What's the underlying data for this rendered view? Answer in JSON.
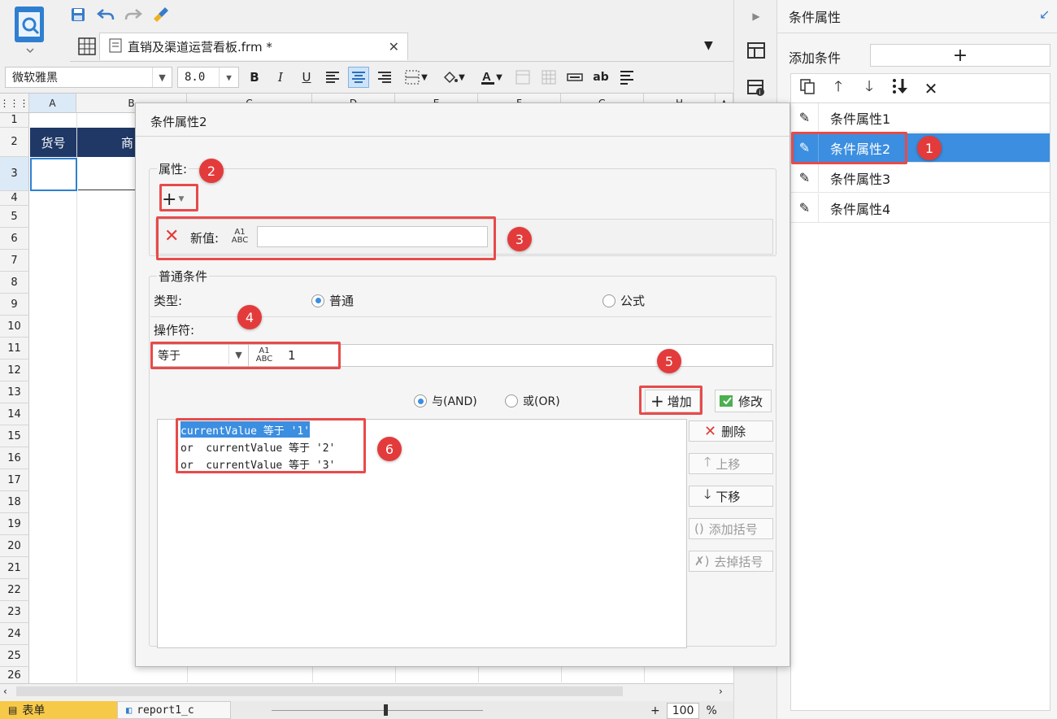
{
  "editor": {
    "file_tab": "直销及渠道运营看板.frm *",
    "font_name": "微软雅黑",
    "font_size": "8.0",
    "columns": [
      "A",
      "B",
      "C",
      "D",
      "E",
      "F",
      "G",
      "H"
    ],
    "rows": [
      "1",
      "2",
      "3",
      "4",
      "5",
      "6",
      "7",
      "8",
      "9",
      "10",
      "11",
      "12",
      "13",
      "14",
      "15",
      "16",
      "17",
      "18",
      "19",
      "20",
      "21",
      "22",
      "23",
      "24",
      "25",
      "26"
    ],
    "header_cells": [
      "货号",
      "商"
    ],
    "sheet_tabs": [
      "表单",
      "report1_c"
    ],
    "zoom": "100",
    "zoom_unit": "%",
    "bold": "B",
    "italic": "I",
    "underline": "U",
    "abc": "ab"
  },
  "right_panel": {
    "title": "条件属性",
    "add_label": "添加条件",
    "add_icon": "+",
    "items": [
      {
        "label": "条件属性1",
        "selected": false
      },
      {
        "label": "条件属性2",
        "selected": true
      },
      {
        "label": "条件属性3",
        "selected": false
      },
      {
        "label": "条件属性4",
        "selected": false
      }
    ]
  },
  "dialog": {
    "title": "条件属性2",
    "property_label": "属性:",
    "new_value_label": "新值:",
    "new_value": "",
    "general_condition": "普通条件",
    "type_label": "类型:",
    "type_options": [
      "普通",
      "公式"
    ],
    "operator_label": "操作符:",
    "operator_value": "等于",
    "operand_value": "1",
    "logic_options": [
      "与(AND)",
      "或(OR)"
    ],
    "buttons": {
      "add": "增加",
      "modify": "修改",
      "delete": "删除",
      "move_up": "上移",
      "move_down": "下移",
      "add_bracket": "添加括号",
      "remove_bracket": "去掉括号"
    },
    "conditions": [
      "currentValue 等于 '1'",
      "or  currentValue 等于 '2'",
      "or  currentValue 等于 '3'"
    ],
    "abc_top": "A1",
    "abc_bottom": "ABC"
  },
  "annotations": [
    "1",
    "2",
    "3",
    "4",
    "5",
    "6"
  ],
  "colors": {
    "accent": "#3b8ee0",
    "annotation": "#e33b3b",
    "header_fill": "#1f3866"
  }
}
